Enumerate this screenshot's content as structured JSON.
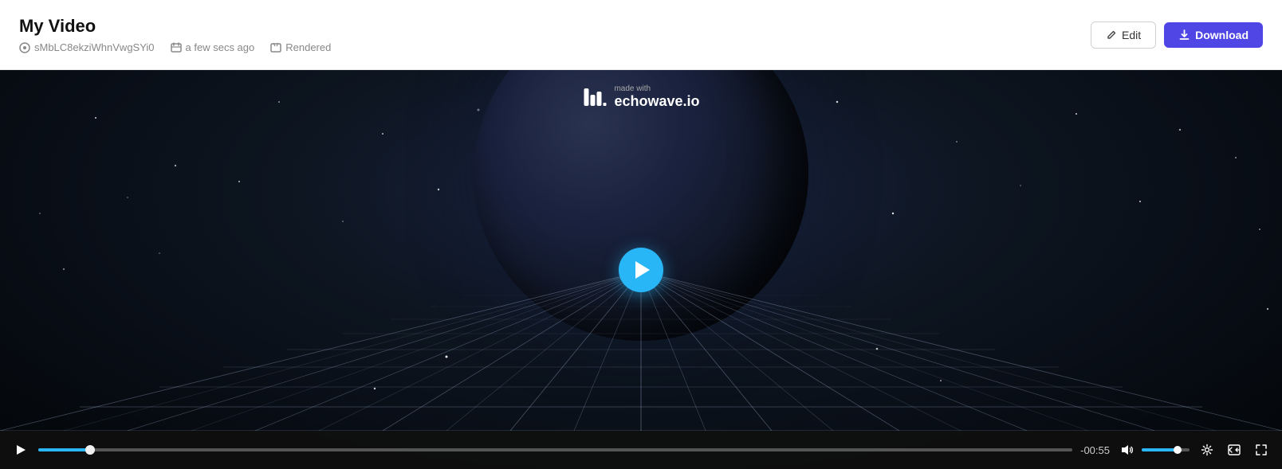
{
  "header": {
    "title": "My Video",
    "meta": {
      "id": "sMbLC8ekziWhnVwgSYi0",
      "timestamp": "a few secs ago",
      "status": "Rendered"
    },
    "buttons": {
      "edit_label": "Edit",
      "download_label": "Download"
    }
  },
  "player": {
    "watermark": {
      "brand": "echowave.io",
      "sub": "made with"
    },
    "time": "-00:55",
    "progress_percent": 5,
    "volume_percent": 75
  },
  "colors": {
    "accent": "#4f46e5",
    "player_accent": "#29b6f6",
    "bg": "#f5f5f5",
    "header_bg": "#ffffff"
  }
}
